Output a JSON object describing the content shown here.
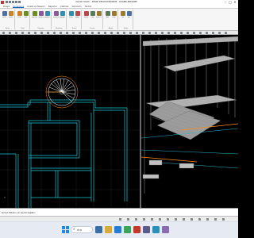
{
  "window": {
    "title": "ideCAD Statik – RESMİ DEĞERLENDİRME – DEĞERLENDİRME",
    "controls": [
      "–",
      "□",
      "✕"
    ]
  },
  "ribbon_tabs": [
    "Dosya",
    "Modelleme",
    "Analiz ve Tasarım",
    "Raporlar",
    "Çizimler",
    "Görünüm",
    "Yardım"
  ],
  "ribbon_groups": [
    {
      "label": "Kolon",
      "buttons": [
        "Kolon",
        "Perde"
      ]
    },
    {
      "label": "Kiriş",
      "buttons": [
        "Kiriş",
        "Hatıl"
      ]
    },
    {
      "label": "Döşeme",
      "buttons": [
        "Döşeme",
        "Nervür",
        "Asmolen"
      ]
    },
    {
      "label": "Merdiven",
      "buttons": [
        "Merdiven",
        "Rampa"
      ]
    },
    {
      "label": "Temel",
      "buttons": [
        "Temel",
        "Radye"
      ]
    },
    {
      "label": "Duvar",
      "buttons": [
        "Duvar",
        "Kapı",
        "Pencere"
      ]
    },
    {
      "label": "Akslar",
      "buttons": [
        "Aks",
        "Ölçü"
      ]
    },
    {
      "label": "Yükler",
      "buttons": [
        "Yük",
        "Kar"
      ]
    }
  ],
  "command_line": {
    "text": "Komut: Bitiren için seçimi başlatın"
  },
  "viewports": {
    "plan": {
      "name": "plan-view",
      "axis_label": "Y"
    },
    "model_3d": {
      "name": "3d-view"
    }
  },
  "taskbar": {
    "search_placeholder": "Ara",
    "search_icon": "search-icon",
    "start_icon": "windows-start-icon"
  },
  "colors": {
    "plan_lines": "#19c6d6",
    "accent_tab": "#1a5fb4",
    "stair_orange": "#ff8c1a"
  }
}
